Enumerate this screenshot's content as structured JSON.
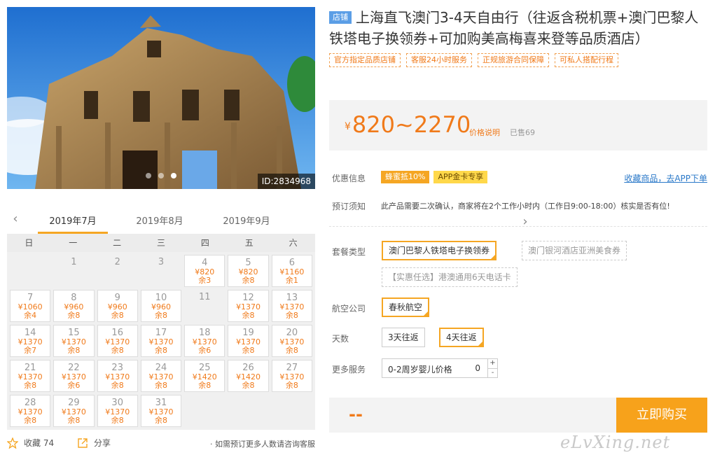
{
  "photo": {
    "id_label": "ID:2834968",
    "dots": 3,
    "active_dot": 3
  },
  "calendar": {
    "months": [
      "2019年7月",
      "2019年8月",
      "2019年9月"
    ],
    "active_month": 0,
    "weekdays": [
      "日",
      "一",
      "二",
      "三",
      "四",
      "五",
      "六"
    ],
    "leading_blanks": 1,
    "days": [
      {
        "d": "1"
      },
      {
        "d": "2"
      },
      {
        "d": "3"
      },
      {
        "d": "4",
        "p": "¥820",
        "r": "余3"
      },
      {
        "d": "5",
        "p": "¥820",
        "r": "余8"
      },
      {
        "d": "6",
        "p": "¥1160",
        "r": "余1"
      },
      {
        "d": "7",
        "p": "¥1060",
        "r": "余4"
      },
      {
        "d": "8",
        "p": "¥960",
        "r": "余8"
      },
      {
        "d": "9",
        "p": "¥960",
        "r": "余8"
      },
      {
        "d": "10",
        "p": "¥960",
        "r": "余8"
      },
      {
        "d": "11"
      },
      {
        "d": "12",
        "p": "¥1370",
        "r": "余8"
      },
      {
        "d": "13",
        "p": "¥1370",
        "r": "余8"
      },
      {
        "d": "14",
        "p": "¥1370",
        "r": "余7"
      },
      {
        "d": "15",
        "p": "¥1370",
        "r": "余8"
      },
      {
        "d": "16",
        "p": "¥1370",
        "r": "余8"
      },
      {
        "d": "17",
        "p": "¥1370",
        "r": "余8"
      },
      {
        "d": "18",
        "p": "¥1370",
        "r": "余6"
      },
      {
        "d": "19",
        "p": "¥1370",
        "r": "余8"
      },
      {
        "d": "20",
        "p": "¥1370",
        "r": "余8"
      },
      {
        "d": "21",
        "p": "¥1370",
        "r": "余8"
      },
      {
        "d": "22",
        "p": "¥1370",
        "r": "余6"
      },
      {
        "d": "23",
        "p": "¥1370",
        "r": "余8"
      },
      {
        "d": "24",
        "p": "¥1370",
        "r": "余8"
      },
      {
        "d": "25",
        "p": "¥1420",
        "r": "余8"
      },
      {
        "d": "26",
        "p": "¥1420",
        "r": "余8"
      },
      {
        "d": "27",
        "p": "¥1370",
        "r": "余8"
      },
      {
        "d": "28",
        "p": "¥1370",
        "r": "余8"
      },
      {
        "d": "29",
        "p": "¥1370",
        "r": "余8"
      },
      {
        "d": "30",
        "p": "¥1370",
        "r": "余8"
      },
      {
        "d": "31",
        "p": "¥1370",
        "r": "余8"
      }
    ]
  },
  "footer_left": {
    "fav_label": "收藏",
    "fav_count": "74",
    "share_label": "分享",
    "note": "· 如需预订更多人数请咨询客服"
  },
  "product": {
    "shop_badge": "店铺",
    "title": "上海直飞澳门3-4天自由行（往返含税机票+澳门巴黎人铁塔电子换领券+可加购美高梅喜来登等品质酒店）",
    "tags": [
      "官方指定品质店铺",
      "客服24小时服务",
      "正规旅游合同保障",
      "可私人搭配行程"
    ],
    "price_currency": "¥",
    "price_range": "820~2270",
    "price_note": "价格说明",
    "sold": "已售69"
  },
  "promo": {
    "label": "优惠信息",
    "badges": [
      "蜂蜜抵10%",
      "APP金卡专享"
    ],
    "fav_link": "收藏商品，去APP下单"
  },
  "booking_note": {
    "label": "预订须知",
    "text": "此产品需要二次确认，商家将在2个工作小时内（工作日9:00-18:00）核实是否有位!"
  },
  "package": {
    "label": "套餐类型",
    "options": [
      "澳门巴黎人铁塔电子换领券",
      "澳门银河酒店亚洲美食券",
      "【实惠任选】港澳通用6天电话卡"
    ]
  },
  "airline": {
    "label": "航空公司",
    "option": "春秋航空"
  },
  "days_opt": {
    "label": "天数",
    "options": [
      "3天往返",
      "4天往返"
    ]
  },
  "more_service": {
    "label": "更多服务",
    "item": "0-2周岁婴儿价格",
    "value": "0",
    "plus": "+",
    "minus": "-"
  },
  "buy": {
    "total": "--",
    "button": "立即购买"
  },
  "watermark": "eLvXing.net",
  "colors": {
    "accent": "#f5a623",
    "price": "#f07a1a",
    "link": "#2b79c9",
    "badge": "#5b9ee6"
  }
}
